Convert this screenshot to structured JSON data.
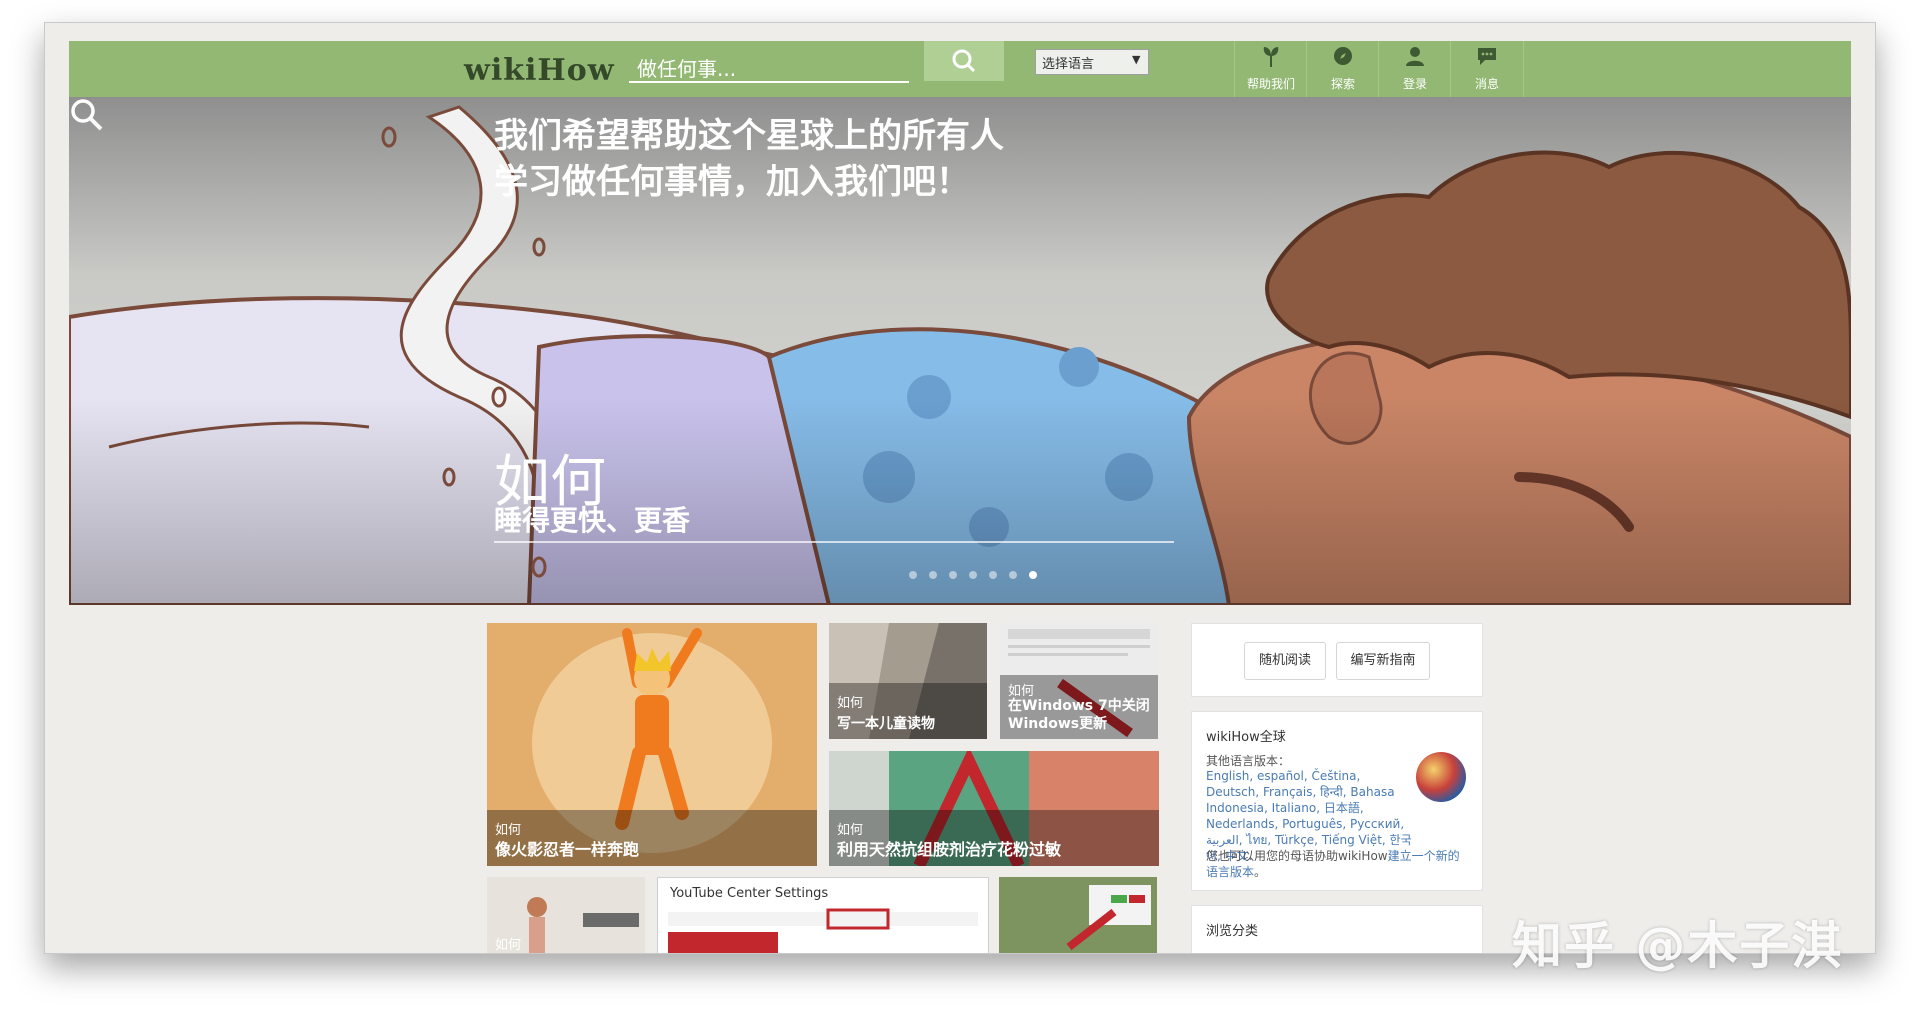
{
  "header": {
    "logo": "wikiHow",
    "search_placeholder": "做任何事...",
    "language_select": "选择语言",
    "nav": [
      {
        "label": "帮助我们",
        "icon": "help-us-icon"
      },
      {
        "label": "探索",
        "icon": "compass-icon"
      },
      {
        "label": "登录",
        "icon": "user-icon"
      },
      {
        "label": "消息",
        "icon": "message-icon"
      }
    ]
  },
  "hero": {
    "title_line1": "我们希望帮助这个星球上的所有人",
    "title_line2": "学习做任何事情，加入我们吧！",
    "how": "如何",
    "subtitle": "睡得更快、更香",
    "slide_count": 7,
    "active_slide": 7
  },
  "cards": [
    {
      "how": "如何",
      "title": "像火影忍者一样奔跑"
    },
    {
      "how": "如何",
      "title": "写一本儿童读物"
    },
    {
      "how": "如何",
      "title": "在Windows 7中关闭Windows更新"
    },
    {
      "how": "如何",
      "title": "利用天然抗组胺剂治疗花粉过敏"
    },
    {
      "how": "如何",
      "title": ""
    },
    {
      "title": "YouTube Center Settings"
    },
    {
      "how": "",
      "title": ""
    }
  ],
  "sidebar": {
    "random_button": "随机阅读",
    "write_button": "编写新指南",
    "global_title": "wikiHow全球",
    "other_languages_label": "其他语言版本：",
    "languages": "English, español, Čeština, Deutsch, Français, हिन्दी, Bahasa Indonesia, Italiano, 日本語, Nederlands, Português, Русский, العربية, ไทย, Türkçe, Tiếng Việt, 한국어, 中文.",
    "note_prefix": "您也可以用您的母语协助wikiHow",
    "note_link": "建立一个新的语言版本",
    "note_suffix": "。",
    "browse_title": "浏览分类"
  },
  "watermark": "知乎 @木子淇"
}
